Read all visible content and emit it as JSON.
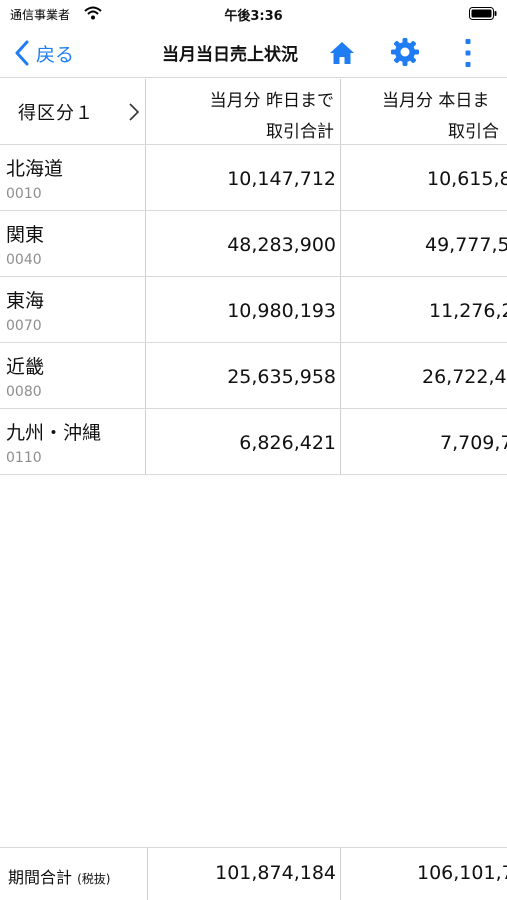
{
  "status_bar": {
    "carrier": "通信事業者",
    "time": "午後3:36"
  },
  "nav": {
    "back_label": "戻る",
    "title": "当月当日売上状況",
    "accent_color": "#1f7cf2"
  },
  "table": {
    "group_selector_label": "得区分１",
    "columns": [
      {
        "line1": "当月分 昨日まで",
        "line2": "取引合計"
      },
      {
        "line1": "当月分 本日ま",
        "line2": "取引合"
      }
    ],
    "rows": [
      {
        "name": "北海道",
        "code": "0010",
        "value_a": "10,147,712",
        "value_b": "10,615,8"
      },
      {
        "name": "関東",
        "code": "0040",
        "value_a": "48,283,900",
        "value_b": "49,777,5"
      },
      {
        "name": "東海",
        "code": "0070",
        "value_a": "10,980,193",
        "value_b": "11,276,2"
      },
      {
        "name": "近畿",
        "code": "0080",
        "value_a": "25,635,958",
        "value_b": "26,722,4"
      },
      {
        "name": "九州・沖縄",
        "code": "0110",
        "value_a": "6,826,421",
        "value_b": "7,709,7"
      }
    ]
  },
  "footer": {
    "label": "期間合計",
    "label_note": "(税抜)",
    "total_a": "101,874,184",
    "total_b": "106,101,7"
  }
}
